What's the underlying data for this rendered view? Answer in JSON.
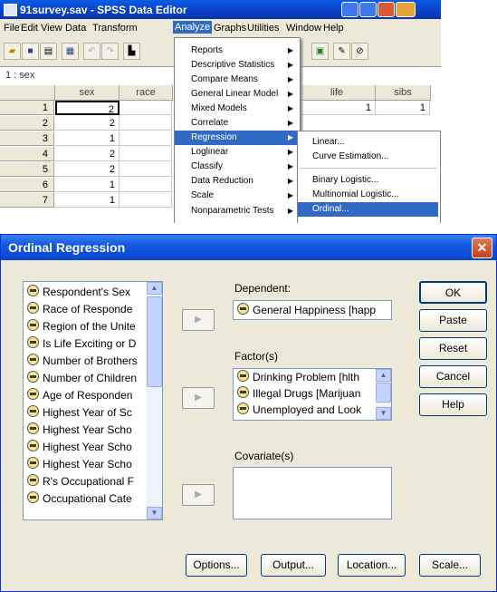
{
  "spss": {
    "window_title": "91survey.sav - SPSS Data Editor",
    "menu": [
      "File",
      "Edit",
      "View",
      "Data",
      "Transform",
      "Analyze",
      "Graphs",
      "Utilities",
      "Window",
      "Help"
    ],
    "active_menu": "Analyze",
    "cell_ref": "1 : sex",
    "columns": [
      "sex",
      "race",
      "life",
      "sibs"
    ],
    "rows": [
      {
        "n": "1",
        "sex": "2",
        "life": "1",
        "sibs": "1"
      },
      {
        "n": "2",
        "sex": "2"
      },
      {
        "n": "3",
        "sex": "1"
      },
      {
        "n": "4",
        "sex": "2"
      },
      {
        "n": "5",
        "sex": "2"
      },
      {
        "n": "6",
        "sex": "1"
      },
      {
        "n": "7",
        "sex": "1"
      }
    ],
    "analyze_menu": [
      "Reports",
      "Descriptive Statistics",
      "Compare Means",
      "General Linear Model",
      "Mixed Models",
      "Correlate",
      "Regression",
      "Loglinear",
      "Classify",
      "Data Reduction",
      "Scale",
      "Nonparametric Tests"
    ],
    "regression_menu": [
      "Linear...",
      "Curve Estimation...",
      "Binary Logistic...",
      "Multinomial Logistic...",
      "Ordinal..."
    ]
  },
  "dialog": {
    "title": "Ordinal Regression",
    "close_glyph": "✕",
    "source_variables": [
      "Respondent's Sex",
      "Race of Responde",
      "Region of the Unite",
      "Is Life Exciting or D",
      "Number of Brothers",
      "Number of Children",
      "Age of Responden",
      "Highest Year of Sc",
      "Highest Year Scho",
      "Highest Year Scho",
      "Highest Year Scho",
      "R's Occupational F",
      "Occupational Cate"
    ],
    "dependent_label": "Dependent:",
    "dependent_value": "General Happiness [happ",
    "factors_label": "Factor(s)",
    "factors": [
      "Drinking Problem [hlth",
      "Illegal Drugs [Marijuan",
      "Unemployed and Look"
    ],
    "covariates_label": "Covariate(s)",
    "buttons": {
      "ok": "OK",
      "paste": "Paste",
      "reset": "Reset",
      "cancel": "Cancel",
      "help": "Help"
    },
    "bottom_buttons": {
      "options": "Options...",
      "output": "Output...",
      "location": "Location...",
      "scale": "Scale..."
    },
    "arrow_glyph": "▶"
  }
}
